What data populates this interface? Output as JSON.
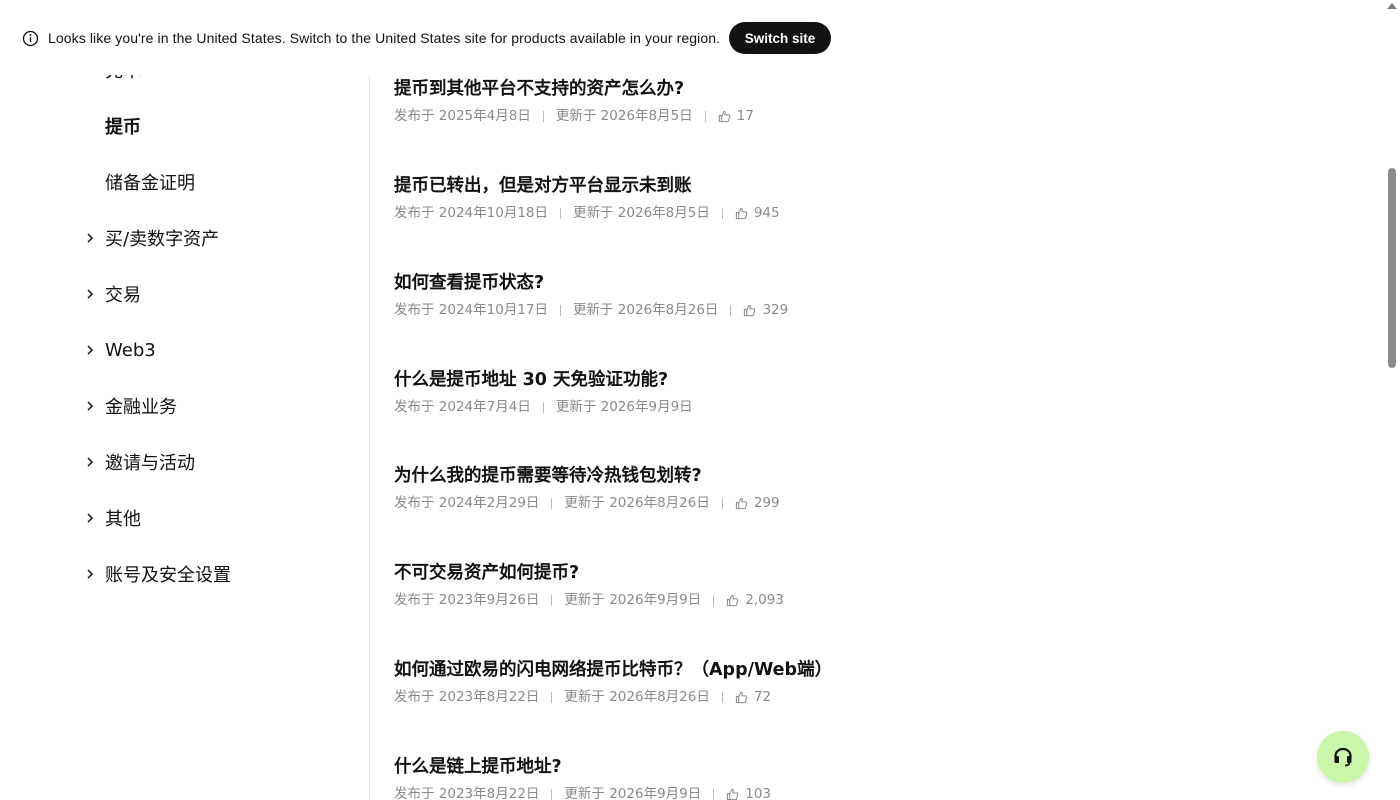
{
  "banner": {
    "message": "Looks like you're in the United States. Switch to the United States site for products available in your region.",
    "switch_label": "Switch site",
    "icon": "info-icon"
  },
  "sidebar": {
    "partial_item": "充本",
    "items": [
      {
        "label": "提币",
        "active": true,
        "expandable": false
      },
      {
        "label": "储备金证明",
        "active": false,
        "expandable": false
      },
      {
        "label": "买/卖数字资产",
        "active": false,
        "expandable": true
      },
      {
        "label": "交易",
        "active": false,
        "expandable": true
      },
      {
        "label": "Web3",
        "active": false,
        "expandable": true
      },
      {
        "label": "金融业务",
        "active": false,
        "expandable": true
      },
      {
        "label": "邀请与活动",
        "active": false,
        "expandable": true
      },
      {
        "label": "其他",
        "active": false,
        "expandable": true
      },
      {
        "label": "账号及安全设置",
        "active": false,
        "expandable": true
      }
    ]
  },
  "articles": [
    {
      "title": "提币到其他平台不支持的资产怎么办?",
      "published": "发布于 2025年4月8日",
      "updated": "更新于 2026年8月5日",
      "likes": "17"
    },
    {
      "title": "提币已转出，但是对方平台显示未到账",
      "published": "发布于 2024年10月18日",
      "updated": "更新于 2026年8月5日",
      "likes": "945"
    },
    {
      "title": "如何查看提币状态?",
      "published": "发布于 2024年10月17日",
      "updated": "更新于 2026年8月26日",
      "likes": "329"
    },
    {
      "title": "什么是提币地址 30 天免验证功能?",
      "published": "发布于 2024年7月4日",
      "updated": "更新于 2026年9月9日",
      "likes": ""
    },
    {
      "title": "为什么我的提币需要等待冷热钱包划转?",
      "published": "发布于 2024年2月29日",
      "updated": "更新于 2026年8月26日",
      "likes": "299"
    },
    {
      "title": "不可交易资产如何提币?",
      "published": "发布于 2023年9月26日",
      "updated": "更新于 2026年9月9日",
      "likes": "2,093"
    },
    {
      "title": "如何通过欧易的闪电网络提币比特币？（App/Web端）",
      "published": "发布于 2023年8月22日",
      "updated": "更新于 2026年8月26日",
      "likes": "72"
    },
    {
      "title": "什么是链上提币地址?",
      "published": "发布于 2023年8月22日",
      "updated": "更新于 2026年9月9日",
      "likes": "103"
    }
  ],
  "support": {
    "icon": "headset-icon",
    "color": "#c9f6a8"
  }
}
